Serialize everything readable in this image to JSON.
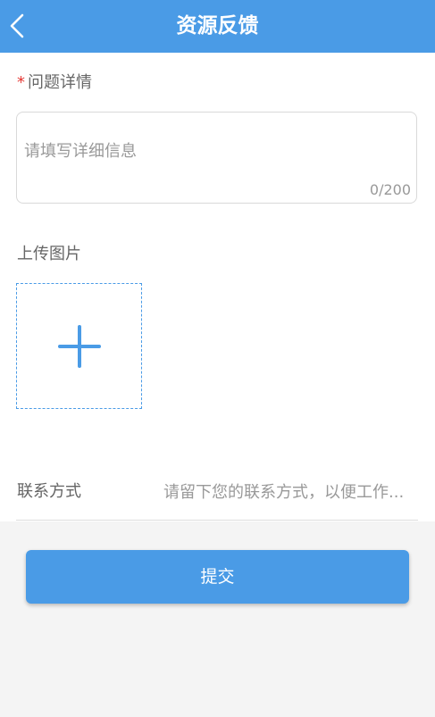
{
  "header": {
    "title": "资源反馈",
    "back_icon": "chevron-left-icon",
    "background_color": "#4a9be6"
  },
  "detail": {
    "required_mark": "*",
    "label": "问题详情",
    "placeholder": "请填写详细信息",
    "value": "",
    "char_count": "0/200"
  },
  "upload": {
    "label": "上传图片",
    "add_icon": "plus-icon"
  },
  "contact": {
    "label": "联系方式",
    "placeholder": "请留下您的联系方式，以便工作...",
    "value": ""
  },
  "submit": {
    "label": "提交",
    "color": "#4a9be6"
  }
}
